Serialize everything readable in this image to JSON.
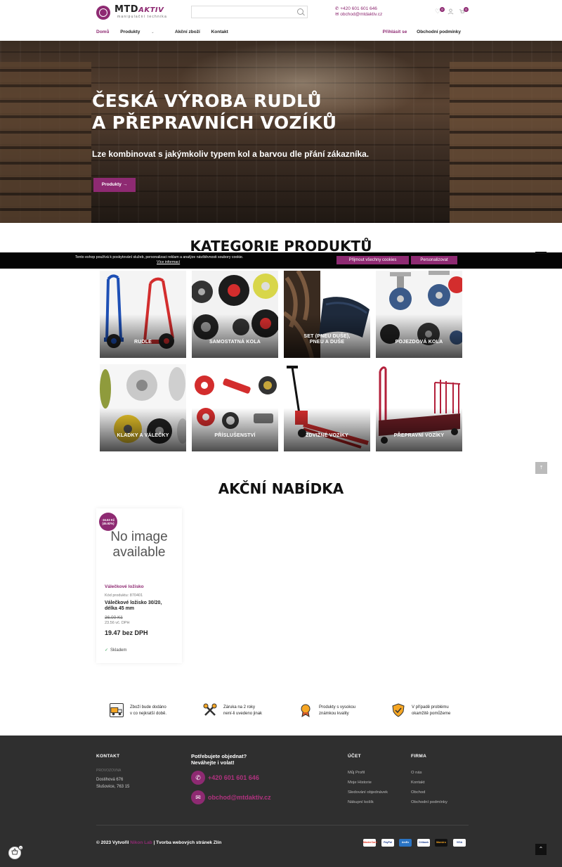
{
  "header": {
    "logo_main": "MTD",
    "logo_accent": "AKTIV",
    "logo_tagline": "manipulační technika",
    "search_placeholder": "",
    "phone": "+420 601 601 646",
    "email": "obchod@mtdaktiv.cz",
    "wishlist_count": "0",
    "cart_count": "0"
  },
  "nav": {
    "items": [
      "Domů",
      "Produkty",
      "Akční zboží",
      "Kontakt"
    ],
    "right": [
      "Přihlásit se",
      "Obchodní podmínky"
    ]
  },
  "hero": {
    "title_line1": "ČESKÁ VÝROBA RUDLŮ",
    "title_line2": "A PŘEPRAVNÍCH VOZÍKŮ",
    "subtitle": "Lze kombinovat s jakýmkoliv typem kol a barvou dle přání zákazníka.",
    "button": "Produkty →"
  },
  "categories": {
    "title": "KATEGORIE PRODUKTŮ",
    "items": [
      {
        "label": "RUDLE",
        "icon": "hand-truck"
      },
      {
        "label": "SAMOSTATNÁ KOLA",
        "icon": "wheels"
      },
      {
        "label": "SET (PNEU DUŠE), PNEU A DUŠE",
        "icon": "tires"
      },
      {
        "label": "POJEZDOVÁ KOLA",
        "icon": "caster-wheels"
      },
      {
        "label": "KLADKY A VÁLEČKY",
        "icon": "rollers"
      },
      {
        "label": "PŘÍSLUŠENSTVÍ",
        "icon": "accessories"
      },
      {
        "label": "ZDVIŽNÉ VOZÍKY",
        "icon": "pallet-jack"
      },
      {
        "label": "PŘEPRAVNÍ VOZÍKY",
        "icon": "platform-trolley"
      }
    ]
  },
  "cookie": {
    "text": "Tento eshop používá k poskytování služeb, personalizaci reklam a analýze návštěvnosti soubory cookie.",
    "more": "Více informací",
    "accept": "Přijmout všechny cookies",
    "personalize": "Personalizovat"
  },
  "offer": {
    "title": "AKČNÍ NABÍDKA",
    "product": {
      "badge_line1": "-16.53 Kč",
      "badge_line2": "(45.92%)",
      "image_text_line1": "No image",
      "image_text_line2": "available",
      "category": "Válečkové ložisko",
      "code": "Kód produktu: 870401",
      "name": "Válečkové ložisko 30/20, délka 45 mm",
      "old_price": "36.00 Kč",
      "vat_price": "23.56 vč. DPH",
      "price": "19.47 bez DPH",
      "stock": "Skladem"
    }
  },
  "benefits": [
    {
      "line1": "Zboží bude dodáno",
      "line2": "v co nejkratší době.",
      "icon": "truck-icon"
    },
    {
      "line1": "Záruka na 2 roky",
      "line2": "není-li uvedeno jinak",
      "icon": "tools-icon"
    },
    {
      "line1": "Produkty s vysokou",
      "line2": "známkou kvality",
      "icon": "medal-icon"
    },
    {
      "line1": "V případě problému",
      "line2": "okamžitě pomůžeme",
      "icon": "shield-icon"
    }
  ],
  "footer": {
    "contact_title": "KONTAKT",
    "provozovna": "PROVOZOVNA",
    "address_line1": "Dostihová 676",
    "address_line2": "Slušovice, 763 15",
    "need_line1": "Potřebujete objednat?",
    "need_line2": "Neváhejte i volat!",
    "phone": "+420 601 601 646",
    "email": "obchod@mtdaktiv.cz",
    "account_title": "ÚČET",
    "account_links": [
      "Můj Profil",
      "Moje Historie",
      "Sledování objednávek",
      "Nákupní košík"
    ],
    "company_title": "FIRMA",
    "company_links": [
      "O nás",
      "Kontakt",
      "Obchod",
      "Obchodní podmínky"
    ],
    "copyright_prefix": "© 2023 Vytvořil",
    "copyright_brand": "Nikon Lab",
    "copyright_suffix": "| Tvorba webových stránek Zlín",
    "payments": [
      "MasterCard",
      "PayPal",
      "AmEx",
      "Citibank",
      "Maestro",
      "VISA"
    ]
  },
  "floating_cart_count": "0",
  "colors": {
    "brand": "#8e2a72",
    "footer_bg": "#2f2f2f"
  }
}
